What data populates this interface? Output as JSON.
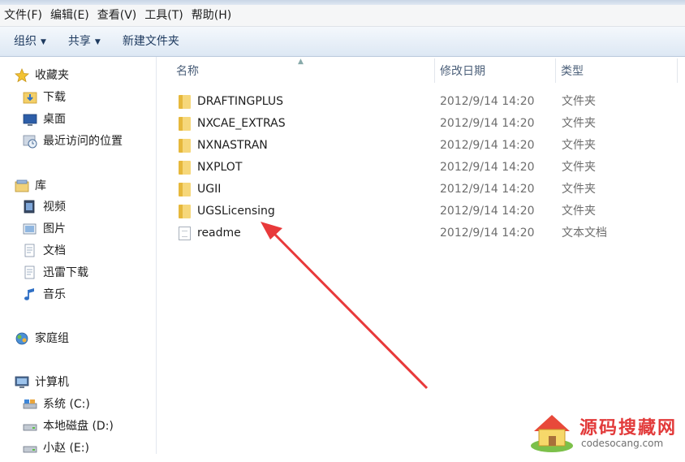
{
  "menu": [
    "文件(F)",
    "编辑(E)",
    "查看(V)",
    "工具(T)",
    "帮助(H)"
  ],
  "toolbar": {
    "organize": "组织",
    "share": "共享",
    "new_folder": "新建文件夹"
  },
  "nav": {
    "favorites": "收藏夹",
    "downloads": "下载",
    "desktop": "桌面",
    "recent": "最近访问的位置",
    "libraries": "库",
    "videos": "视频",
    "pictures": "图片",
    "documents": "文档",
    "thunder": "迅雷下载",
    "music": "音乐",
    "homegroup": "家庭组",
    "computer": "计算机",
    "drive_c": "系统 (C:)",
    "drive_d": "本地磁盘 (D:)",
    "drive_e": "小赵 (E:)"
  },
  "columns": {
    "name": "名称",
    "date": "修改日期",
    "type": "类型"
  },
  "files": [
    {
      "name": "DRAFTINGPLUS",
      "date": "2012/9/14 14:20",
      "type": "文件夹"
    },
    {
      "name": "NXCAE_EXTRAS",
      "date": "2012/9/14 14:20",
      "type": "文件夹"
    },
    {
      "name": "NXNASTRAN",
      "date": "2012/9/14 14:20",
      "type": "文件夹"
    },
    {
      "name": "NXPLOT",
      "date": "2012/9/14 14:20",
      "type": "文件夹"
    },
    {
      "name": "UGII",
      "date": "2012/9/14 14:20",
      "type": "文件夹"
    },
    {
      "name": "UGSLicensing",
      "date": "2012/9/14 14:20",
      "type": "文件夹"
    },
    {
      "name": "readme",
      "date": "2012/9/14 14:20",
      "type": "文本文档"
    }
  ],
  "watermark": {
    "title": "源码搜藏网",
    "url": "codesocang.com"
  },
  "colors": {
    "arrow": "#e8393a",
    "folder": "#f6d77a",
    "toolbar": "#dde8f4"
  }
}
